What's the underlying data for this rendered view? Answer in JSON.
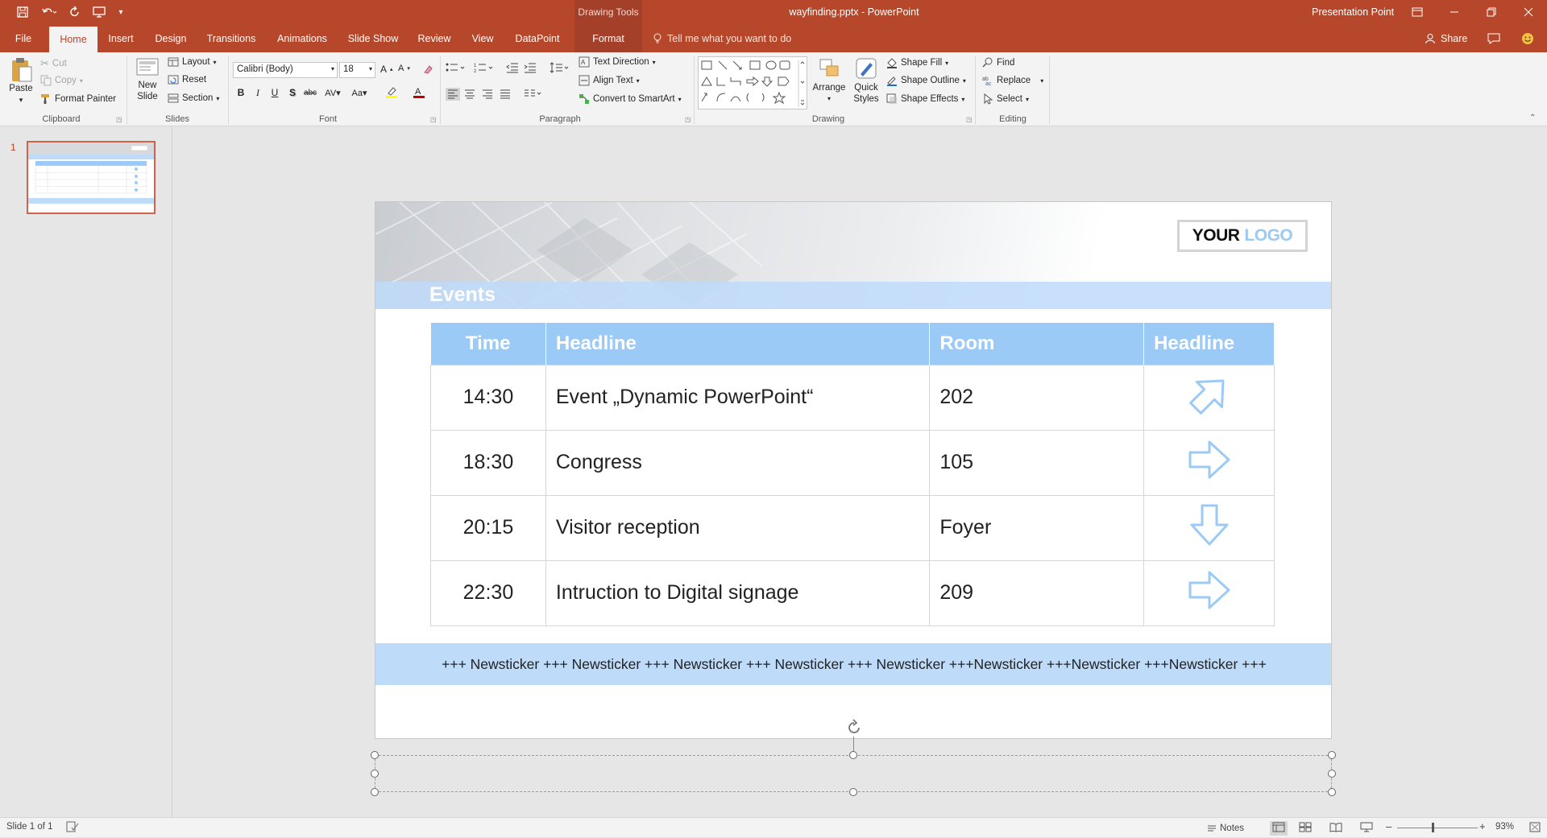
{
  "titlebar": {
    "drawing_tools": "Drawing Tools",
    "filename": "wayfinding.pptx",
    "separator": "-",
    "app": "PowerPoint",
    "user": "Presentation Point"
  },
  "tabs": [
    "File",
    "Home",
    "Insert",
    "Design",
    "Transitions",
    "Animations",
    "Slide Show",
    "Review",
    "View",
    "DataPoint",
    "Format"
  ],
  "tell_me": "Tell me what you want to do",
  "share": "Share",
  "ribbon": {
    "clipboard": {
      "label": "Clipboard",
      "paste": "Paste",
      "cut": "Cut",
      "copy": "Copy",
      "format_painter": "Format Painter"
    },
    "slides": {
      "label": "Slides",
      "new_slide_1": "New",
      "new_slide_2": "Slide",
      "layout": "Layout",
      "reset": "Reset",
      "section": "Section"
    },
    "font": {
      "label": "Font",
      "font_name": "Calibri (Body)",
      "font_size": "18"
    },
    "paragraph": {
      "label": "Paragraph",
      "text_direction": "Text Direction",
      "align_text": "Align Text",
      "convert_smartart": "Convert to SmartArt"
    },
    "drawing": {
      "label": "Drawing",
      "arrange": "Arrange",
      "quick_styles_1": "Quick",
      "quick_styles_2": "Styles",
      "shape_fill": "Shape Fill",
      "shape_outline": "Shape Outline",
      "shape_effects": "Shape Effects"
    },
    "editing": {
      "label": "Editing",
      "find": "Find",
      "replace": "Replace",
      "select": "Select"
    }
  },
  "thumbnail": {
    "number": "1"
  },
  "slide": {
    "title": "Events",
    "logo_part1": "YOUR",
    "logo_part2": "LOGO",
    "headers": [
      "Time",
      "Headline",
      "Room",
      "Headline"
    ],
    "rows": [
      {
        "time": "14:30",
        "headline": "Event „Dynamic PowerPoint“",
        "room": "202",
        "direction": "up-right"
      },
      {
        "time": "18:30",
        "headline": "Congress",
        "room": "105",
        "direction": "right"
      },
      {
        "time": "20:15",
        "headline": "Visitor reception",
        "room": "Foyer",
        "direction": "down"
      },
      {
        "time": "22:30",
        "headline": "Intruction to Digital signage",
        "room": "209",
        "direction": "right"
      }
    ],
    "ticker": "+++ Newsticker +++ Newsticker +++ Newsticker +++ Newsticker +++ Newsticker +++Newsticker +++Newsticker +++Newsticker +++",
    "accent": "#9ccaf6"
  },
  "status": {
    "slide_info": "Slide 1 of 1",
    "notes": "Notes",
    "zoom": "93%",
    "zoom_out": "–",
    "zoom_in": "+"
  }
}
